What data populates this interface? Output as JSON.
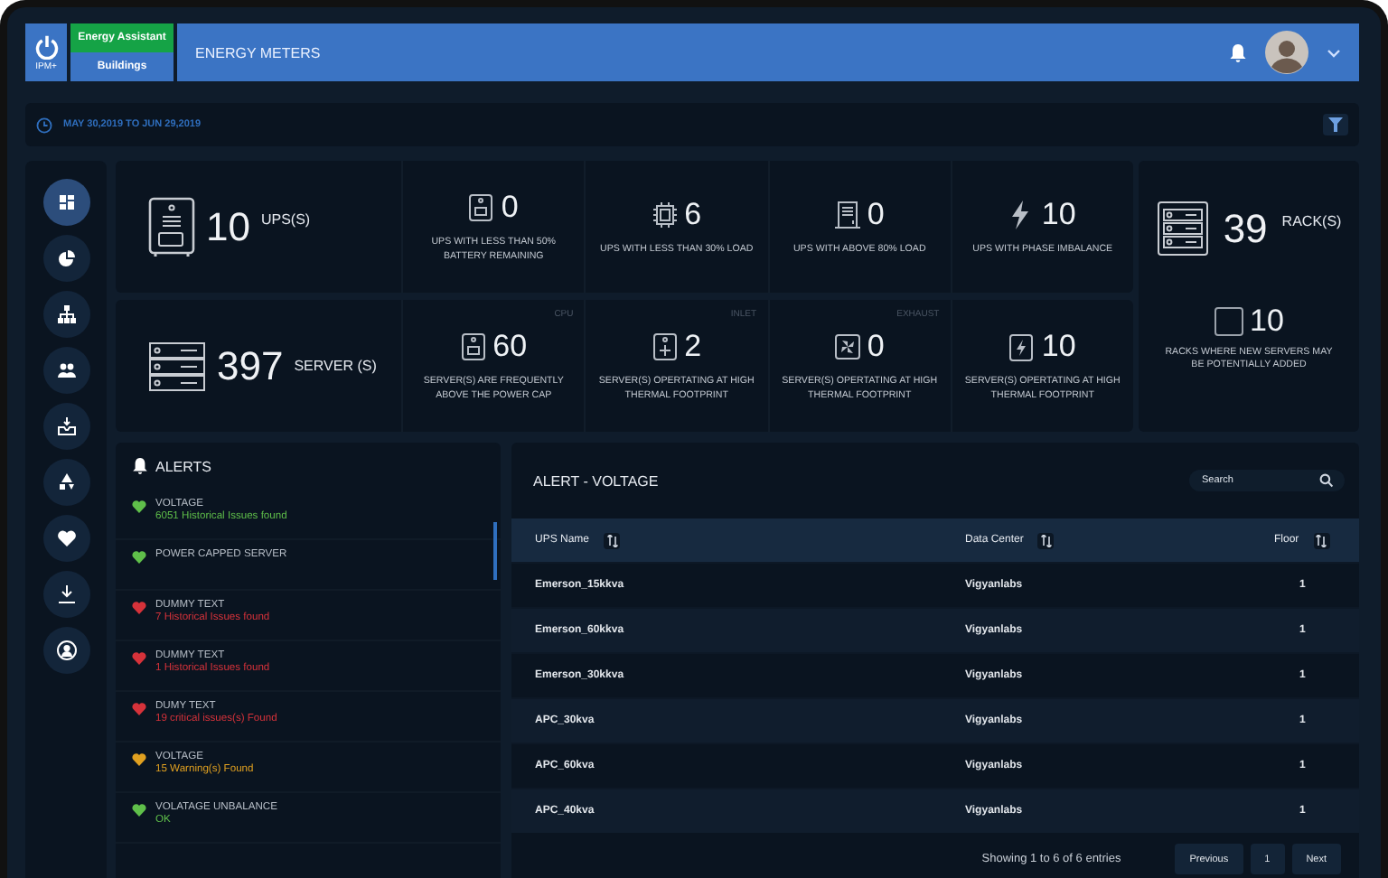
{
  "header": {
    "logo": "IPM+",
    "app_tabs": [
      {
        "label": "Energy Assistant",
        "selected": true
      },
      {
        "label": "Buildings",
        "selected": false
      }
    ],
    "title": "ENERGY METERS"
  },
  "date_range": "MAY 30,2019 TO JUN 29,2019",
  "sidebar": {
    "items": [
      {
        "kind": "dashboard",
        "selected": true
      },
      {
        "kind": "pie",
        "selected": false
      },
      {
        "kind": "hierarchy",
        "selected": false
      },
      {
        "kind": "people",
        "selected": false
      },
      {
        "kind": "inbox",
        "selected": false
      },
      {
        "kind": "recycle",
        "selected": false
      },
      {
        "kind": "heart",
        "selected": false
      },
      {
        "kind": "download",
        "selected": false
      },
      {
        "kind": "user",
        "selected": false
      }
    ]
  },
  "ups_row": {
    "value": "10",
    "unit": "UPS(S)",
    "cells": [
      {
        "kind": "battery",
        "value": "0",
        "label": "UPS WITH LESS THAN 50% BATTERY REMAINING"
      },
      {
        "kind": "chip",
        "value": "6",
        "label": "UPS WITH LESS THAN 30% LOAD"
      },
      {
        "kind": "cabinet",
        "value": "0",
        "label": "UPS WITH ABOVE 80% LOAD"
      },
      {
        "kind": "bolt",
        "value": "10",
        "label": "UPS WITH PHASE IMBALANCE"
      }
    ]
  },
  "server_row": {
    "value": "397",
    "unit": "SERVER (S)",
    "cells": [
      {
        "kind": "battery",
        "corner": "CPU",
        "value": "60",
        "label": "SERVER(S) ARE FREQUENTLY ABOVE THE POWER CAP"
      },
      {
        "kind": "plus",
        "corner": "INLET",
        "value": "2",
        "label": "SERVER(S) OPERTATING AT HIGH THERMAL FOOTPRINT"
      },
      {
        "kind": "fan",
        "corner": "EXHAUST",
        "value": "0",
        "label": "SERVER(S) OPERTATING AT HIGH THERMAL FOOTPRINT"
      },
      {
        "kind": "charge",
        "value": "10",
        "label": "SERVER(S) OPERTATING AT HIGH THERMAL FOOTPRINT"
      }
    ]
  },
  "racks": {
    "value": "39",
    "unit": "RACK(S)",
    "sub_value": "10",
    "sub_label": "RACKS WHERE NEW SERVERS MAY BE POTENTIALLY ADDED"
  },
  "alerts": {
    "title": "ALERTS",
    "items": [
      {
        "title": "VOLTAGE",
        "detail": "6051 Historical Issues found",
        "color": "#5fbf4a"
      },
      {
        "title": "POWER CAPPED SERVER",
        "color": "#5fbf4a"
      },
      {
        "title": "DUMMY TEXT",
        "detail": "7 Historical Issues found",
        "color": "#d6323a"
      },
      {
        "title": "DUMMY TEXT",
        "detail": "1 Historical Issues found",
        "color": "#d6323a"
      },
      {
        "title": "DUMY TEXT",
        "detail": "19 critical issues(s) Found",
        "color": "#d6323a"
      },
      {
        "title": "VOLTAGE",
        "detail": "15 Warning(s) Found",
        "color": "#e0a020"
      },
      {
        "title": "VOLATAGE UNBALANCE",
        "detail": "OK",
        "color": "#5fbf4a"
      }
    ]
  },
  "table": {
    "title": "ALERT - VOLTAGE",
    "search": {
      "placeholder": "Search"
    },
    "columns": [
      "UPS Name",
      "Data Center",
      "Floor"
    ],
    "rows": [
      [
        "Emerson_15kkva",
        "Vigyanlabs",
        "1"
      ],
      [
        "Emerson_60kkva",
        "Vigyanlabs",
        "1"
      ],
      [
        "Emerson_30kkva",
        "Vigyanlabs",
        "1"
      ],
      [
        "APC_30kva",
        "Vigyanlabs",
        "1"
      ],
      [
        "APC_60kva",
        "Vigyanlabs",
        "1"
      ],
      [
        "APC_40kva",
        "Vigyanlabs",
        "1"
      ]
    ],
    "info": "Showing 1 to 6 of 6 entries",
    "pager": [
      "Previous",
      "1",
      "Next"
    ]
  }
}
